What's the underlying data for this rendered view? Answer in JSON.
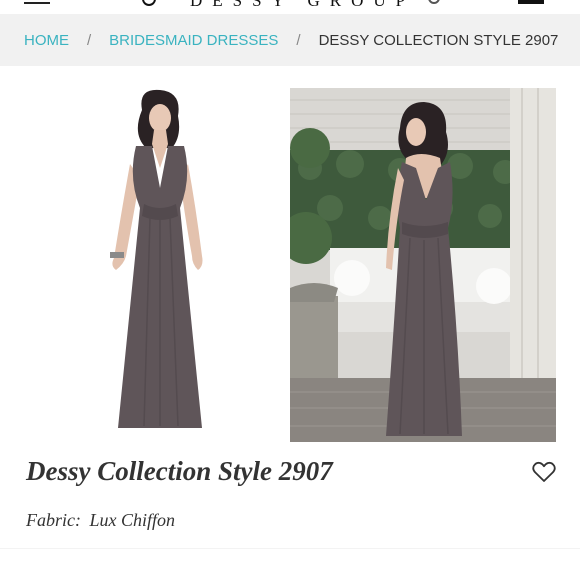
{
  "header": {
    "logo_text": "DESSY GROUP"
  },
  "breadcrumb": {
    "items": [
      {
        "label": "HOME"
      },
      {
        "label": "BRIDESMAID DRESSES"
      },
      {
        "label": "DESSY COLLECTION STYLE 2907"
      }
    ],
    "separator": "/"
  },
  "product": {
    "title": "Dessy Collection Style 2907",
    "fabric_label": "Fabric:",
    "fabric_value": "Lux Chiffon",
    "dress_color": "#5f5559",
    "accent_color": "#3ab3c0"
  },
  "icons": {
    "menu": "hamburger-icon",
    "search": "search-icon",
    "account": "account-icon",
    "bag": "bag-icon",
    "favorite": "heart-icon"
  }
}
